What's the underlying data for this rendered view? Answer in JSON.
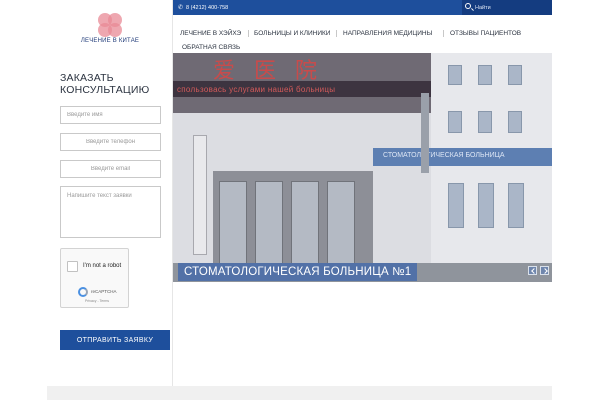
{
  "brand": {
    "name": "ЛЕЧЕНИЕ В КИТАЕ",
    "logo_color": "#e88a95"
  },
  "contact": {
    "phone": "8 (4212) 400-758",
    "phone_icon": "phone-icon"
  },
  "search": {
    "placeholder": "Найти",
    "icon": "search-icon"
  },
  "nav": {
    "items": [
      {
        "label": "ЛЕЧЕНИЕ В ХЭЙХЭ"
      },
      {
        "label": "БОЛЬНИЦЫ И КЛИНИКИ"
      },
      {
        "label": "НАПРАВЛЕНИЯ МЕДИЦИНЫ"
      },
      {
        "label": "ОТЗЫВЫ ПАЦИЕНТОВ"
      },
      {
        "label": "ОБРАТНАЯ СВЯЗЬ"
      }
    ]
  },
  "order_form": {
    "title_line1": "ЗАКАЗАТЬ",
    "title_line2": "КОНСУЛЬТАЦИЮ",
    "name_placeholder": "Введите имя",
    "phone_placeholder": "Введите телефон",
    "email_placeholder": "Введите email",
    "message_placeholder": "Напишите текст заявки",
    "submit_label": "ОТПРАВИТЬ ЗАЯВКУ"
  },
  "captcha": {
    "label": "I'm not a robot",
    "brand": "reCAPTCHA",
    "terms": "Privacy - Terms"
  },
  "hero": {
    "caption": "СТОМАТОЛОГИЧЕСКАЯ БОЛЬНИЦА №1",
    "sign_chars": "爱 医 院",
    "led_text": "спользовaсь услугами нашей больницы",
    "band_text": "СТОМАТОЛОГИЧЕСКАЯ БОЛЬНИЦА",
    "vertical_sign": "黑河仁爱医院"
  },
  "colors": {
    "primary": "#1e4f9c",
    "caption_bg": "#4a6ca8"
  }
}
